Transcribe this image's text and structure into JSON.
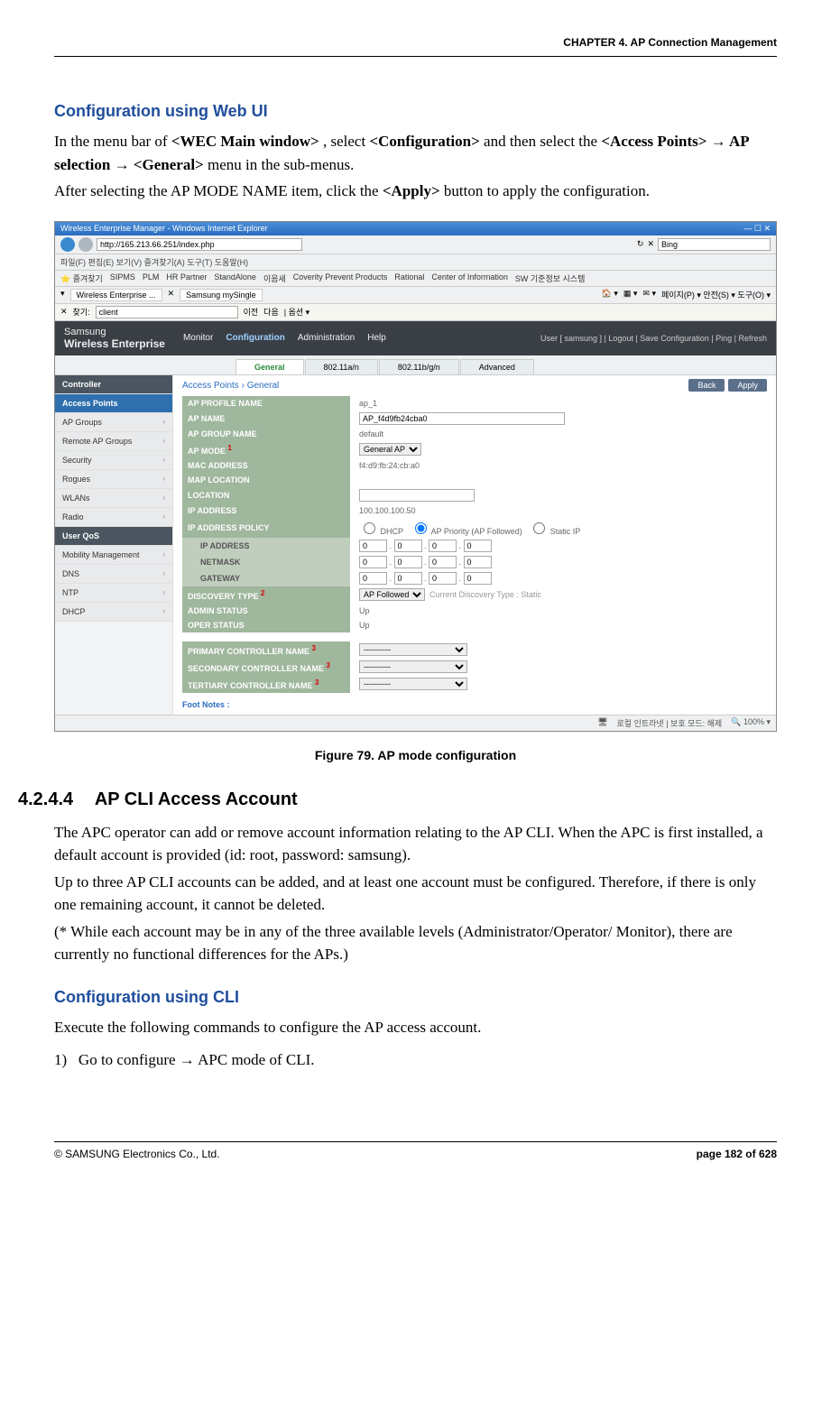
{
  "header": {
    "chapter": "CHAPTER 4. AP Connection Management"
  },
  "section_webui": {
    "heading": "Configuration using Web UI",
    "para1_pre": "In the menu bar of ",
    "para1_b1": "<WEC Main window>",
    "para1_mid1": ", select ",
    "para1_b2": "<Configuration>",
    "para1_mid2": " and then select the ",
    "para1_b3": "<Access Points>",
    "para1_arrow1": " → ",
    "para1_b4": "AP selection",
    "para1_arrow2": " → ",
    "para1_b5": "<General>",
    "para1_end": " menu in the sub-menus.",
    "para2_pre": "After selecting the AP MODE NAME item, click the ",
    "para2_b1": "<Apply>",
    "para2_end": " button to apply the configuration."
  },
  "ie": {
    "title": "Wireless Enterprise Manager - Windows Internet Explorer",
    "url": "http://165.213.66.251/index.php",
    "search": "Bing",
    "menu": "파일(F)  편집(E)  보기(V)  즐겨찾기(A)  도구(T)  도움말(H)",
    "fav_label": "즐겨찾기",
    "fav_items": [
      "SIPMS",
      "PLM",
      "HR Partner",
      "StandAlone",
      "이음새",
      "Coverity Prevent Products",
      "Rational",
      "Center of Information",
      "SW 기준정보 시스템"
    ],
    "tab1": "Wireless Enterprise ...",
    "tab2": "Samsung mySingle",
    "toolbar_right": "페이지(P) ▾  안전(S) ▾  도구(O) ▾",
    "find_label": "찾기:",
    "find_value": "client",
    "find_prev": "이전",
    "find_next": "다음",
    "find_opts": "옵션 ▾",
    "status_zone": "로컬 인트라넷 | 보호 모드: 해제",
    "status_zoom": "100%"
  },
  "we": {
    "brand1": "Samsung",
    "brand2": "Wireless Enterprise",
    "nav": [
      "Monitor",
      "Configuration",
      "Administration",
      "Help"
    ],
    "nav_active": 1,
    "user_line": "User [ samsung ]  |  Logout  |  Save Configuration  |  Ping  |  Refresh",
    "subtabs": [
      "General",
      "802.11a/n",
      "802.11b/g/n",
      "Advanced"
    ],
    "subtab_active": 0,
    "sidebar": [
      {
        "label": "Controller",
        "type": "darkhead"
      },
      {
        "label": "Access Points",
        "type": "active"
      },
      {
        "label": "AP Groups",
        "type": "item"
      },
      {
        "label": "Remote AP Groups",
        "type": "item"
      },
      {
        "label": "Security",
        "type": "item"
      },
      {
        "label": "Rogues",
        "type": "item"
      },
      {
        "label": "WLANs",
        "type": "item"
      },
      {
        "label": "Radio",
        "type": "item"
      },
      {
        "label": "User QoS",
        "type": "darkhead"
      },
      {
        "label": "Mobility Management",
        "type": "item"
      },
      {
        "label": "DNS",
        "type": "item"
      },
      {
        "label": "NTP",
        "type": "item"
      },
      {
        "label": "DHCP",
        "type": "item"
      }
    ],
    "breadcrumb": "Access Points  ›  General",
    "btn_back": "Back",
    "btn_apply": "Apply",
    "fields": {
      "ap_profile_name": {
        "label": "AP PROFILE NAME",
        "value": "ap_1"
      },
      "ap_name": {
        "label": "AP NAME",
        "value": "AP_f4d9fb24cba0"
      },
      "ap_group_name": {
        "label": "AP GROUP NAME",
        "value": "default"
      },
      "ap_mode": {
        "label": "AP MODE",
        "sup": "1",
        "value": "General AP"
      },
      "mac": {
        "label": "MAC ADDRESS",
        "value": "f4:d9:fb:24:cb:a0"
      },
      "map": {
        "label": "MAP LOCATION",
        "value": ""
      },
      "location": {
        "label": "LOCATION",
        "value": ""
      },
      "ip": {
        "label": "IP ADDRESS",
        "value": "100.100.100.50"
      },
      "ip_policy": {
        "label": "IP ADDRESS POLICY",
        "opt1": "DHCP",
        "opt2": "AP Priority (AP Followed)",
        "opt3": "Static IP"
      },
      "ip_addr_sub": {
        "label": "IP ADDRESS",
        "o1": "0",
        "o2": "0",
        "o3": "0",
        "o4": "0"
      },
      "netmask": {
        "label": "NETMASK",
        "o1": "0",
        "o2": "0",
        "o3": "0",
        "o4": "0"
      },
      "gateway": {
        "label": "GATEWAY",
        "o1": "0",
        "o2": "0",
        "o3": "0",
        "o4": "0"
      },
      "discovery": {
        "label": "DISCOVERY TYPE",
        "sup": "2",
        "value": "AP Followed",
        "note": "Current Discovery Type : Static"
      },
      "admin": {
        "label": "ADMIN STATUS",
        "value": "Up"
      },
      "oper": {
        "label": "OPER STATUS",
        "value": "Up"
      },
      "primary": {
        "label": "PRIMARY CONTROLLER NAME",
        "sup": "3",
        "value": "----------"
      },
      "secondary": {
        "label": "SECONDARY CONTROLLER NAME",
        "sup": "3",
        "value": "----------"
      },
      "tertiary": {
        "label": "TERTIARY CONTROLLER NAME",
        "sup": "3",
        "value": "----------"
      }
    },
    "footnotes": "Foot Notes :"
  },
  "figure": {
    "caption": "Figure 79. AP mode configuration"
  },
  "section_4244": {
    "num": "4.2.4.4",
    "title": "AP CLI Access Account",
    "para1": "The APC operator can add or remove account information relating to the AP CLI. When the APC is first installed, a default account is provided (id: root, password: samsung).",
    "para2": "Up to three AP CLI accounts can be added, and at least one account must be configured. Therefore, if there is only one remaining account, it cannot be deleted.",
    "para3": "(* While each account may be in any of the three available levels (Administrator/Operator/ Monitor), there are currently no functional differences for the APs.)"
  },
  "section_cli": {
    "heading": "Configuration using CLI",
    "para": "Execute the following commands to configure the AP access account.",
    "step1_num": "1)",
    "step1_text": "Go to configure → APC mode of CLI."
  },
  "footer": {
    "left": "© SAMSUNG Electronics Co., Ltd.",
    "right": "page 182 of 628"
  }
}
